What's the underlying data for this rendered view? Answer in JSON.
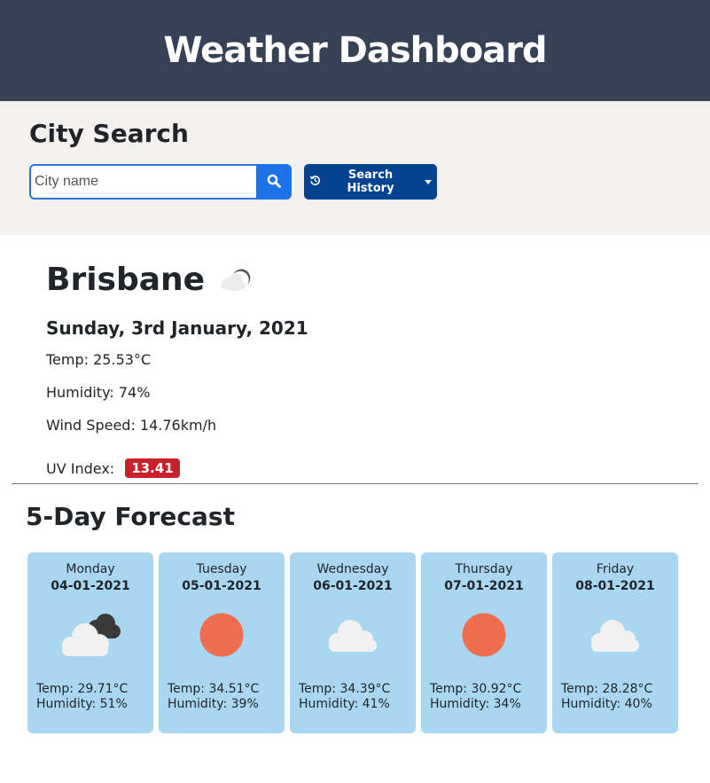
{
  "header": {
    "title": "Weather Dashboard"
  },
  "search": {
    "title": "City Search",
    "placeholder": "City name",
    "history_label": "Search History"
  },
  "current": {
    "city": "Brisbane",
    "icon": "cloudy-night-icon",
    "date": "Sunday, 3rd January, 2021",
    "temp": "Temp: 25.53°C",
    "humidity": "Humidity: 74%",
    "wind": "Wind Speed: 14.76km/h",
    "uv_label": "UV Index:",
    "uv_value": "13.41",
    "uv_color": "#c9212b"
  },
  "forecast": {
    "title": "5-Day Forecast",
    "days": [
      {
        "day": "Monday",
        "date": "04-01-2021",
        "icon": "broken-clouds-icon",
        "temp": "Temp: 29.71°C",
        "humidity": "Humidity: 51%"
      },
      {
        "day": "Tuesday",
        "date": "05-01-2021",
        "icon": "clear-sky-icon",
        "temp": "Temp: 34.51°C",
        "humidity": "Humidity: 39%"
      },
      {
        "day": "Wednesday",
        "date": "06-01-2021",
        "icon": "cloud-icon",
        "temp": "Temp: 34.39°C",
        "humidity": "Humidity: 41%"
      },
      {
        "day": "Thursday",
        "date": "07-01-2021",
        "icon": "clear-sky-icon",
        "temp": "Temp: 30.92°C",
        "humidity": "Humidity: 34%"
      },
      {
        "day": "Friday",
        "date": "08-01-2021",
        "icon": "cloud-icon",
        "temp": "Temp: 28.28°C",
        "humidity": "Humidity: 40%"
      }
    ]
  },
  "colors": {
    "header_bg": "#364156",
    "search_bg": "#f2f1ef",
    "card_bg": "#a9d7f2",
    "history_button": "#03438f",
    "search_button": "#1d72e8",
    "sun": "#ee6e4f"
  }
}
